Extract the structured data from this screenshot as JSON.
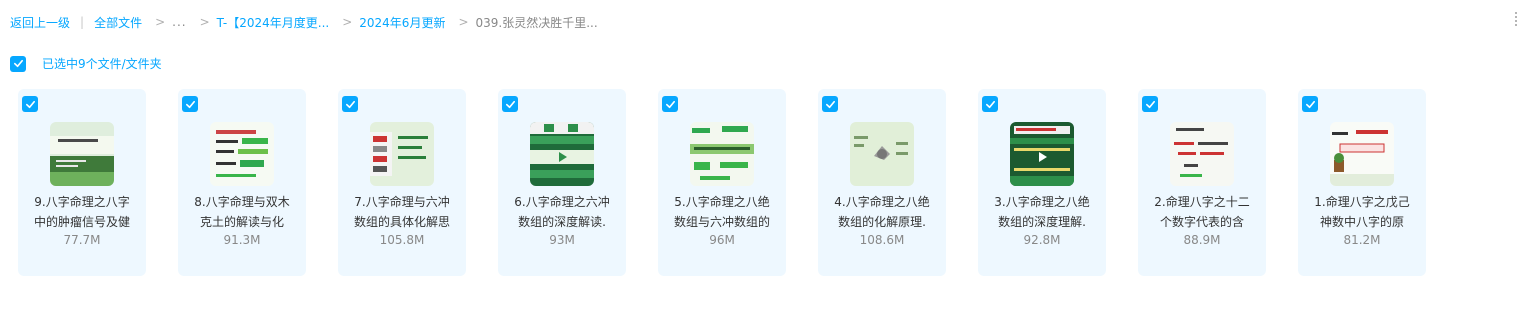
{
  "breadcrumb": {
    "back": "返回上一级",
    "all_files": "全部文件",
    "ellipsis": "...",
    "folder1": "T-【2024年月度更...",
    "folder2": "2024年6月更新",
    "current": "039.张灵然决胜千里..."
  },
  "selection": {
    "label": "已选中9个文件/文件夹"
  },
  "accent_color": "#06a7ff",
  "card_background": "#eef8ff",
  "files": [
    {
      "name_line1": "9.八字命理之八字",
      "name_line2": "中的肿瘤信号及健",
      "size": "77.7M",
      "selected": true,
      "thumb_icon": "video-thumbnail-icon"
    },
    {
      "name_line1": "8.八字命理与双木",
      "name_line2": "克土的解读与化",
      "size": "91.3M",
      "selected": true,
      "thumb_icon": "video-thumbnail-icon"
    },
    {
      "name_line1": "7.八字命理与六冲",
      "name_line2": "数组的具体化解思",
      "size": "105.8M",
      "selected": true,
      "thumb_icon": "video-thumbnail-icon"
    },
    {
      "name_line1": "6.八字命理之六冲",
      "name_line2": "数组的深度解读.",
      "size": "93M",
      "selected": true,
      "thumb_icon": "video-thumbnail-icon"
    },
    {
      "name_line1": "5.八字命理之八绝",
      "name_line2": "数组与六冲数组的",
      "size": "96M",
      "selected": true,
      "thumb_icon": "video-thumbnail-icon"
    },
    {
      "name_line1": "4.八字命理之八绝",
      "name_line2": "数组的化解原理.",
      "size": "108.6M",
      "selected": true,
      "thumb_icon": "video-thumbnail-icon"
    },
    {
      "name_line1": "3.八字命理之八绝",
      "name_line2": "数组的深度理解.",
      "size": "92.8M",
      "selected": true,
      "thumb_icon": "video-thumbnail-icon"
    },
    {
      "name_line1": "2.命理八字之十二",
      "name_line2": "个数字代表的含",
      "size": "88.9M",
      "selected": true,
      "thumb_icon": "video-thumbnail-icon"
    },
    {
      "name_line1": "1.命理八字之戊己",
      "name_line2": "神数中八字的原",
      "size": "81.2M",
      "selected": true,
      "thumb_icon": "video-thumbnail-icon"
    }
  ]
}
